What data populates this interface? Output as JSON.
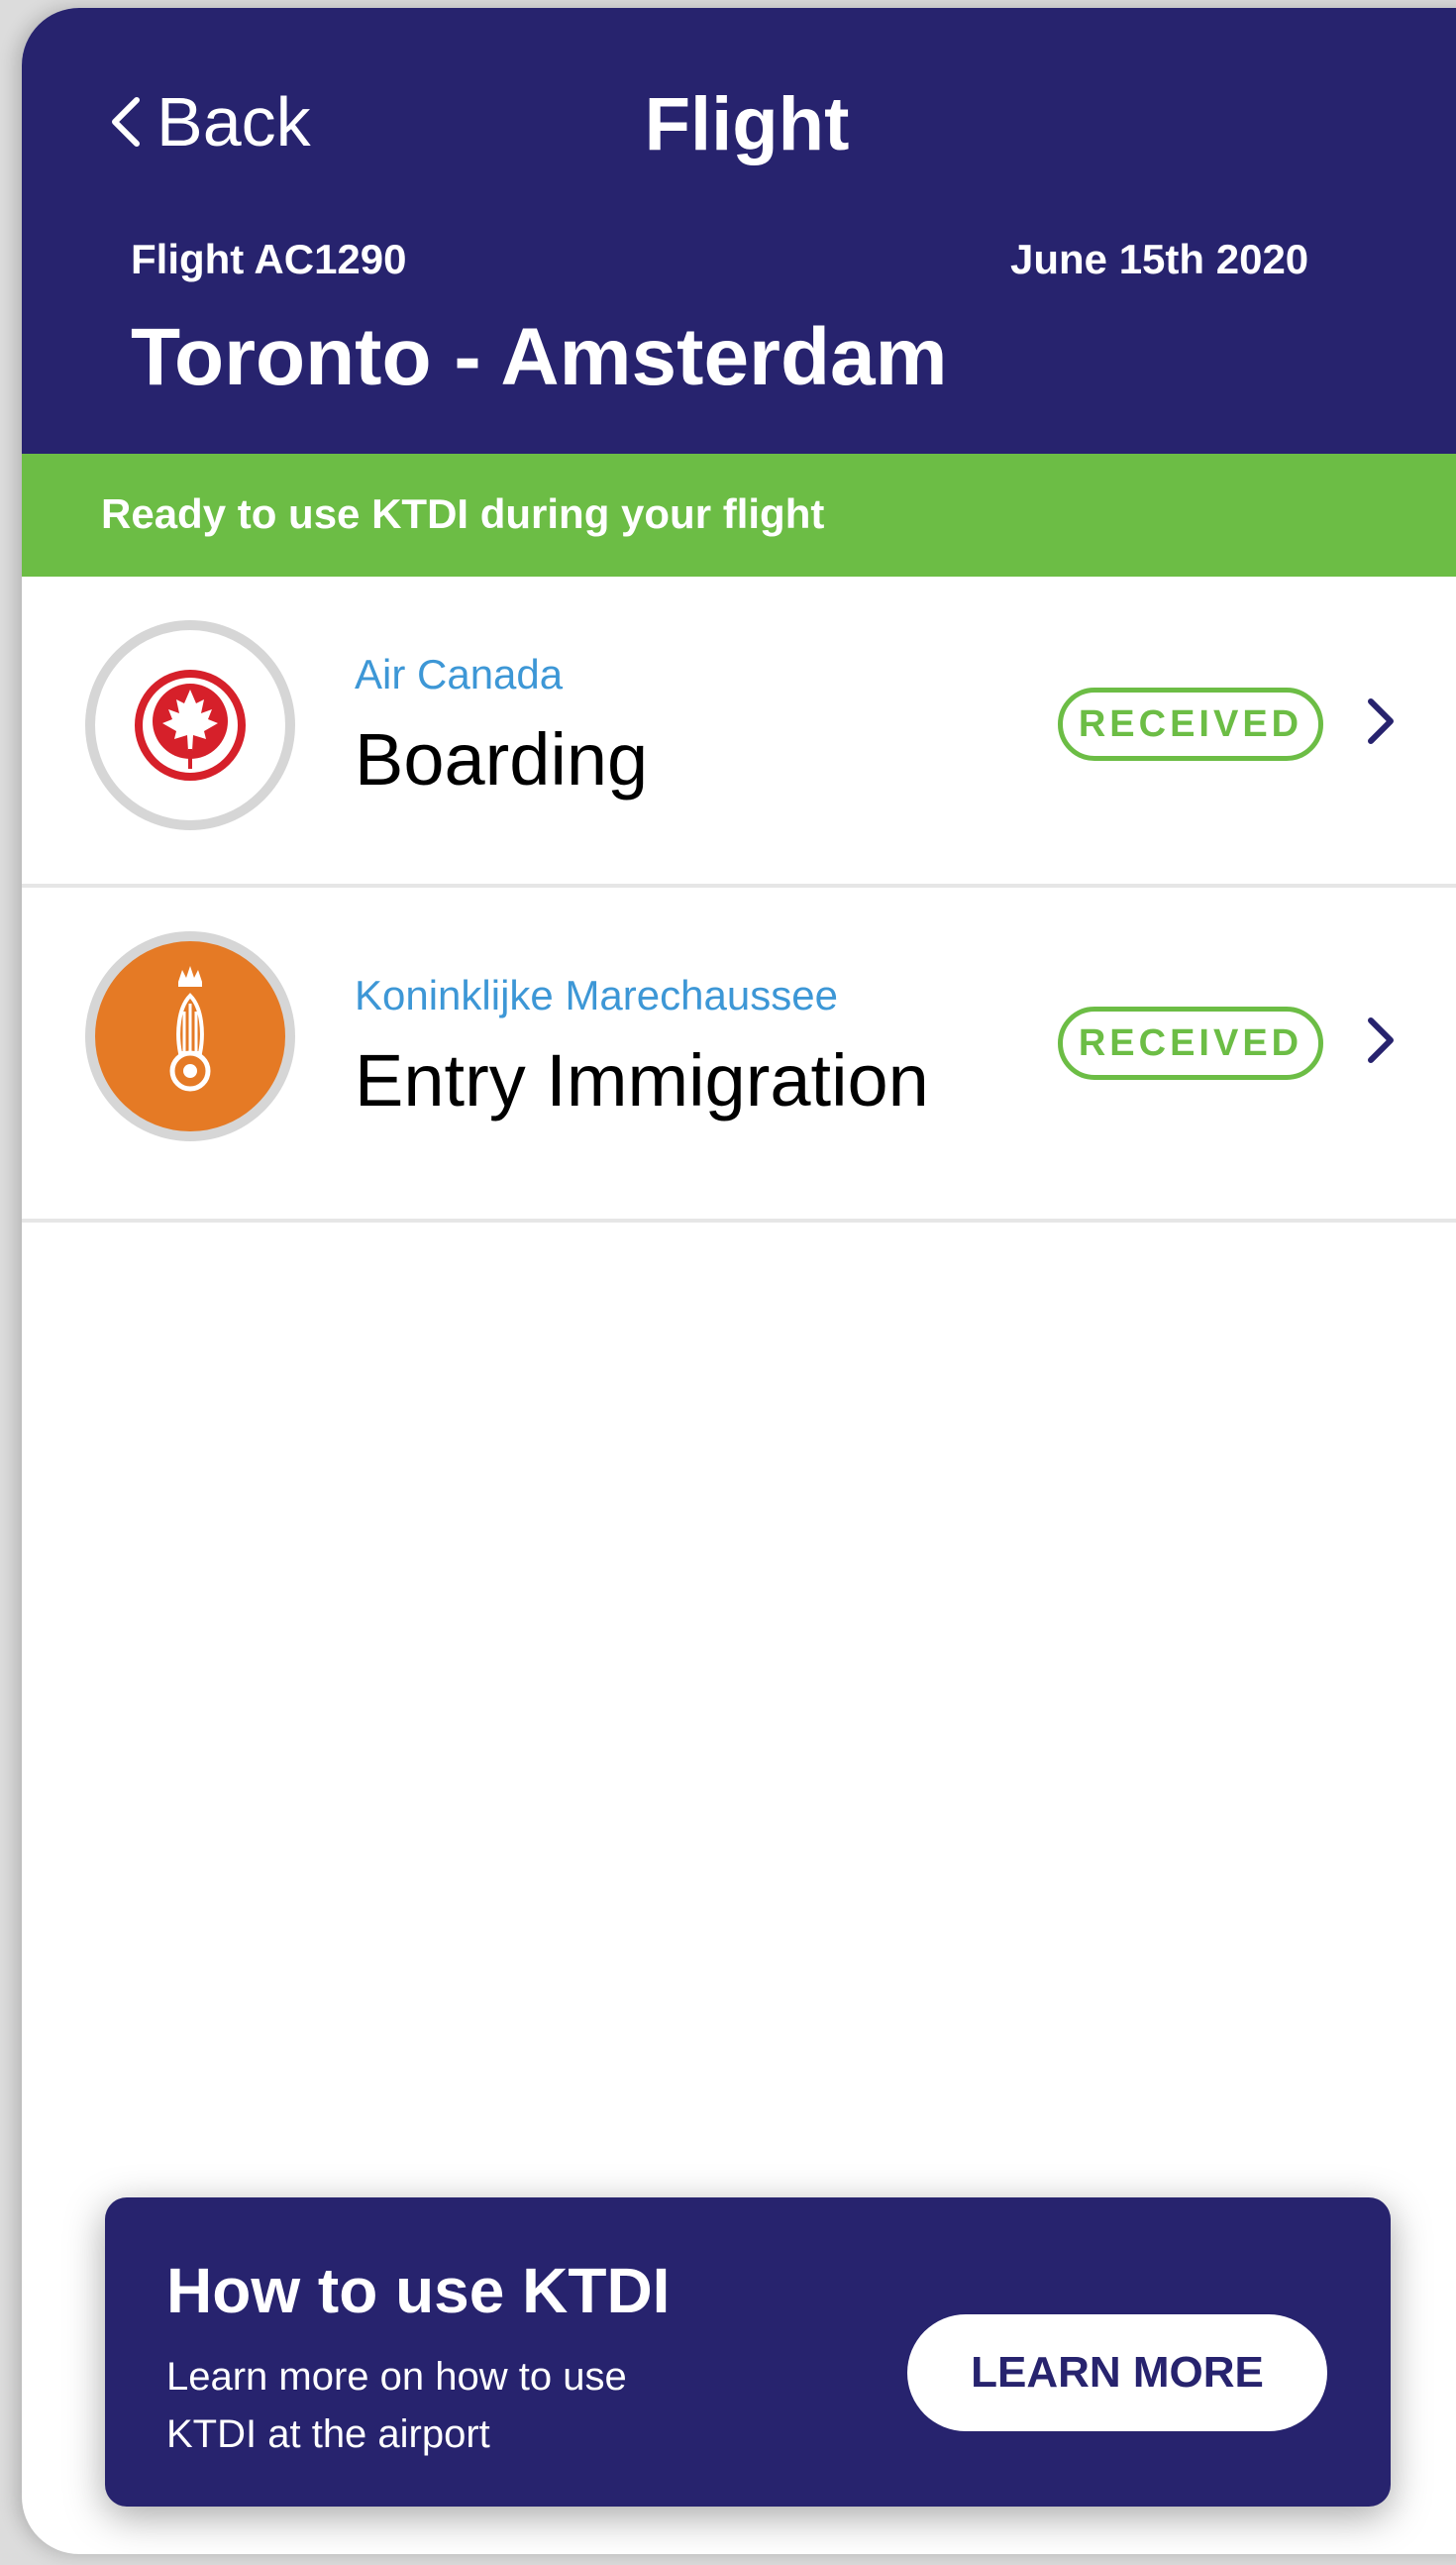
{
  "header": {
    "back_label": "Back",
    "title": "Flight",
    "flight_number": "Flight AC1290",
    "date": "June 15th 2020",
    "route": "Toronto - Amsterdam"
  },
  "status_banner": {
    "text": "Ready to use KTDI during your flight"
  },
  "items": [
    {
      "organization": "Air Canada",
      "title": "Boarding",
      "status": "RECEIVED",
      "icon": "air-canada-maple-leaf-logo"
    },
    {
      "organization": "Koninklijke Marechaussee",
      "title": "Entry Immigration",
      "status": "RECEIVED",
      "icon": "marechaussee-grenade-crest-logo"
    }
  ],
  "help_card": {
    "title": "How to use KTDI",
    "description": "Learn more on how to use KTDI at the airport",
    "button_label": "LEARN MORE"
  },
  "colors": {
    "header_bg": "#27236e",
    "banner_green": "#6cbd45",
    "org_blue": "#3d97d6",
    "air_canada_red": "#d6202a",
    "marechaussee_orange": "#e57a25"
  }
}
